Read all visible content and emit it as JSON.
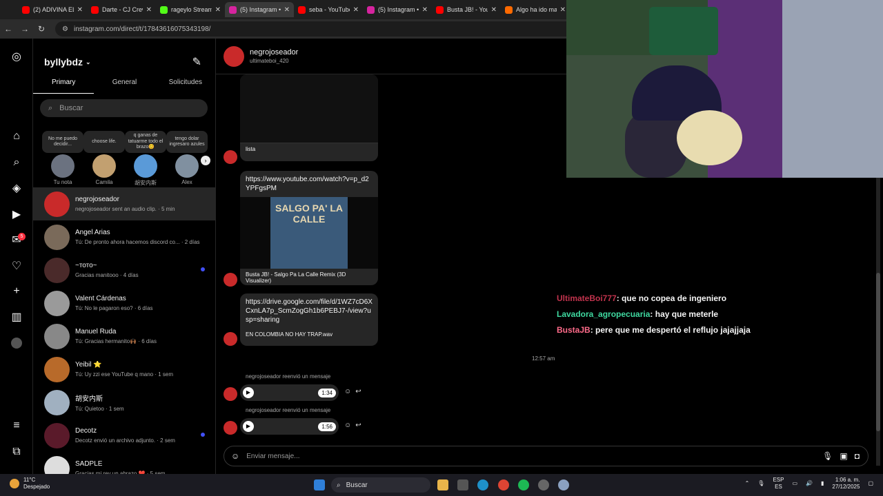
{
  "browser": {
    "tabs": [
      {
        "title": "(2) ADIVINA EL",
        "color": "#ff0000"
      },
      {
        "title": "Darte - CJ Crew",
        "color": "#ff0000"
      },
      {
        "title": "rageylo Stream",
        "color": "#53fc18"
      },
      {
        "title": "(5) Instagram •",
        "color": "#d6249f"
      },
      {
        "title": "seba - YouTube",
        "color": "#ff0000"
      },
      {
        "title": "(5) Instagram •",
        "color": "#d6249f"
      },
      {
        "title": "Busta JB! - You",
        "color": "#ff0000"
      },
      {
        "title": "Algo ha ido ma",
        "color": "#ff6a00"
      }
    ],
    "url": "instagram.com/direct/t/17843616075343198/"
  },
  "sidebar": {
    "username": "byllybdz",
    "tabs": [
      "Primary",
      "General",
      "Solicitudes"
    ],
    "search_placeholder": "Buscar",
    "badge": "5",
    "notes": [
      {
        "bubble": "No me puedo decidir...",
        "name": "Tu nota"
      },
      {
        "bubble": "choose life.",
        "name": "Camila"
      },
      {
        "bubble": "q ganas de tatuarme todo el brazo😊",
        "name": "胡安内斯"
      },
      {
        "bubble": "tengo dolar ingresaro azules",
        "name": "Alex"
      }
    ],
    "conversations": [
      {
        "name": "negrojoseador",
        "msg": "negrojoseador sent an audio clip. · 5 min",
        "unread": false,
        "selected": true
      },
      {
        "name": "Angel Arias",
        "msg": "Tú: De pronto ahora hacemos discord co... · 2 días",
        "unread": false
      },
      {
        "name": "~тото~",
        "msg": "Gracias manitooo · 4 días",
        "unread": true
      },
      {
        "name": "Valent Cárdenas",
        "msg": "Tú: No le pagaron eso? · 6 días",
        "unread": false
      },
      {
        "name": "Manuel Ruda",
        "msg": "Tú: Gracias hermanito🙌🏾 · 6 días",
        "unread": false
      },
      {
        "name": "Yeibil ⭐",
        "msg": "Tú: Uy zzi ese YouTube q mano · 1 sem",
        "unread": false
      },
      {
        "name": "胡安内斯",
        "msg": "Tú: Quietoo · 1 sem",
        "unread": false
      },
      {
        "name": "Decotz",
        "msg": "Decotz envió un archivo adjunto. · 2 sem",
        "unread": true
      },
      {
        "name": "SADPLE",
        "msg": "Gracias mi rey un abrazo ❤️ · 5 sem",
        "unread": false
      }
    ]
  },
  "chat": {
    "name": "negrojoseador",
    "handle": "ultimateboi_420",
    "msg1_caption": "lista",
    "msg2_link": "https://www.youtube.com/watch?v=p_d2YPFgsPM",
    "msg2_thumb_text": "SALGO PA' LA CALLE",
    "msg2_caption": "Busta JB! - Salgo Pa La Calle Remix (3D Visualizer)",
    "msg3_link": "https://drive.google.com/file/d/1WZ7cD6XCxnLA7p_ScmZogGh1b6PEBJ7-/view?usp=sharing",
    "msg3_caption": "EN COLOMBIA NO HAY TRAP.wav",
    "timestamp": "12:57 am",
    "forwarded_label": "negrojoseador reenvió un mensaje",
    "audio1_duration": "1:34",
    "audio2_duration": "1:56",
    "input_placeholder": "Enviar mensaje..."
  },
  "stream_chat": [
    {
      "user": "UltimateBoi777",
      "text": ": que no copea de ingeniero",
      "color": "#c2334d"
    },
    {
      "user": "Lavadora_agropecuaria",
      "text": ": hay que meterle",
      "color": "#3fd9a0"
    },
    {
      "user": "BustaJB",
      "text": ": pere que me despertó el reflujo jajajjaja",
      "color": "#ff6b8a"
    }
  ],
  "taskbar": {
    "temp": "11°C",
    "weather": "Despejado",
    "search": "Buscar",
    "lang1": "ESP",
    "lang2": "ES",
    "time": "1:06 a. m.",
    "date": "27/12/2025"
  }
}
